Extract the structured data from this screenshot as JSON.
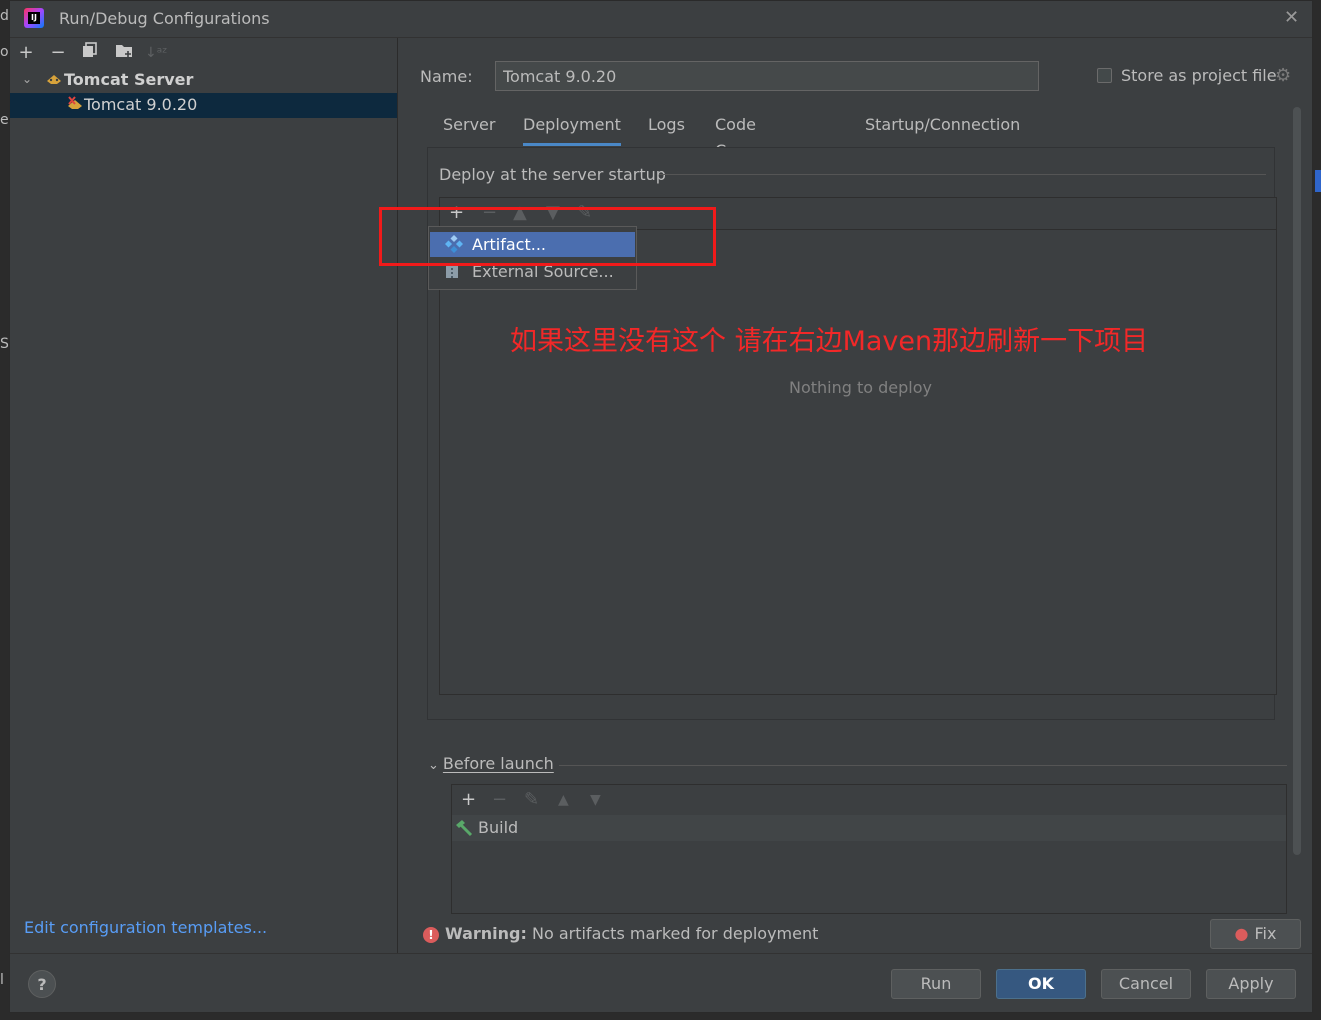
{
  "window": {
    "title": "Run/Debug Configurations"
  },
  "left_edge": {
    "chars": [
      "d",
      "oc",
      "e",
      "S",
      "l"
    ]
  },
  "sidebar": {
    "toolbar": [
      "add-icon",
      "remove-icon",
      "copy-icon",
      "folder-icon",
      "sort-icon"
    ],
    "tree_root": "Tomcat Server",
    "tree_child": "Tomcat 9.0.20",
    "edit_templates": "Edit configuration templates..."
  },
  "config": {
    "name_label": "Name:",
    "name_value": "Tomcat 9.0.20",
    "store_label": "Store as project file"
  },
  "tabs": [
    "Server",
    "Deployment",
    "Logs",
    "Code Coverage",
    "Startup/Connection"
  ],
  "deploy": {
    "title": "Deploy at the server startup",
    "empty_text": "Nothing to deploy"
  },
  "popup": {
    "items": [
      "Artifact...",
      "External Source..."
    ]
  },
  "annotation": {
    "text": "如果这里没有这个  请在右边Maven那边刷新一下项目"
  },
  "before_launch": {
    "label": "Before launch",
    "task": "Build"
  },
  "warning": {
    "label": "Warning:",
    "text": "No artifacts marked for deployment",
    "fix": "Fix"
  },
  "buttons": {
    "run": "Run",
    "ok": "OK",
    "cancel": "Cancel",
    "apply": "Apply",
    "help": "?"
  },
  "colors": {
    "accent": "#4a88c7",
    "selection": "#4b6eaf",
    "annotation": "#f11a1a",
    "link": "#589df6"
  }
}
